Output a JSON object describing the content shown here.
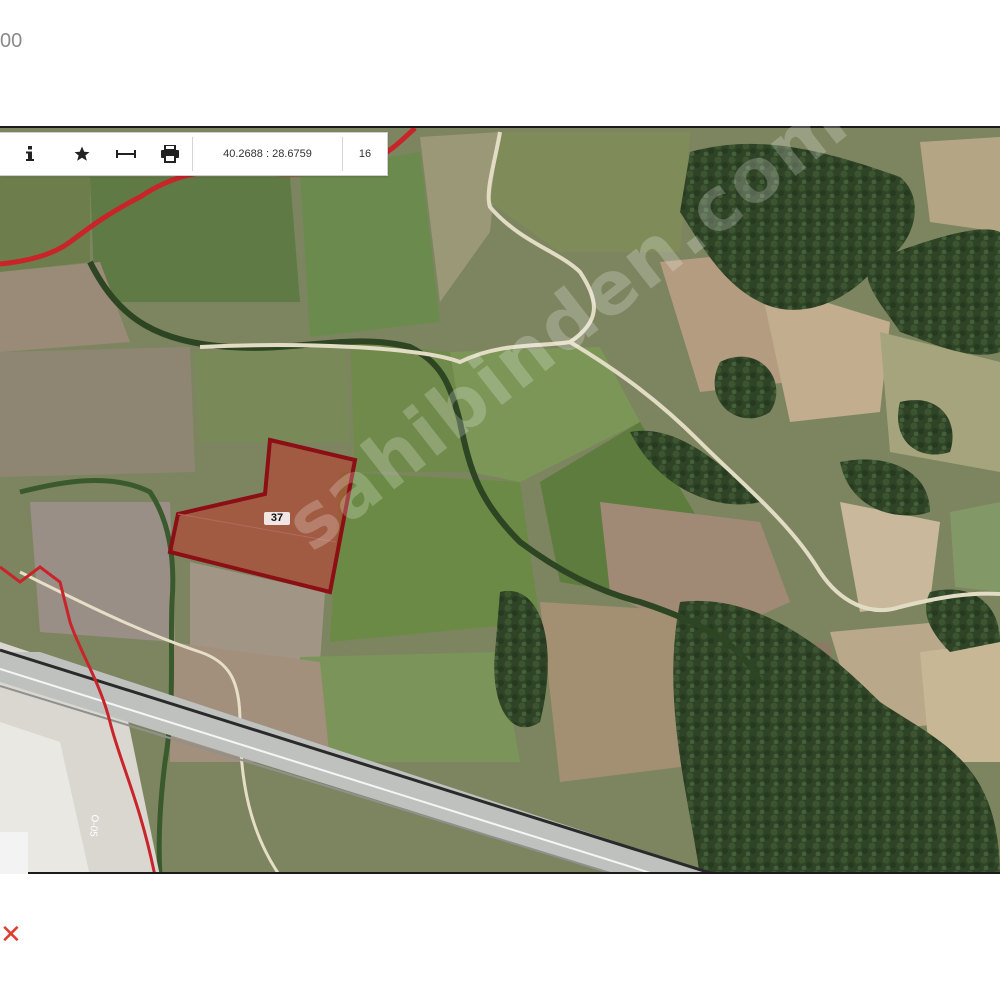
{
  "header": {
    "text": "00"
  },
  "toolbar": {
    "info_icon": "info-icon",
    "favorite_icon": "star-icon",
    "measure_icon": "measure-icon",
    "print_icon": "printer-icon",
    "coordinates": "40.2688 : 28.6759",
    "zoom": "16"
  },
  "map": {
    "parcel_label": "37",
    "watermark": "sahibinden.com",
    "road_number": "O-05",
    "boundary_color": "#c8242a",
    "parcel_color": "#c0392b"
  },
  "footer": {
    "mark": "✕"
  }
}
